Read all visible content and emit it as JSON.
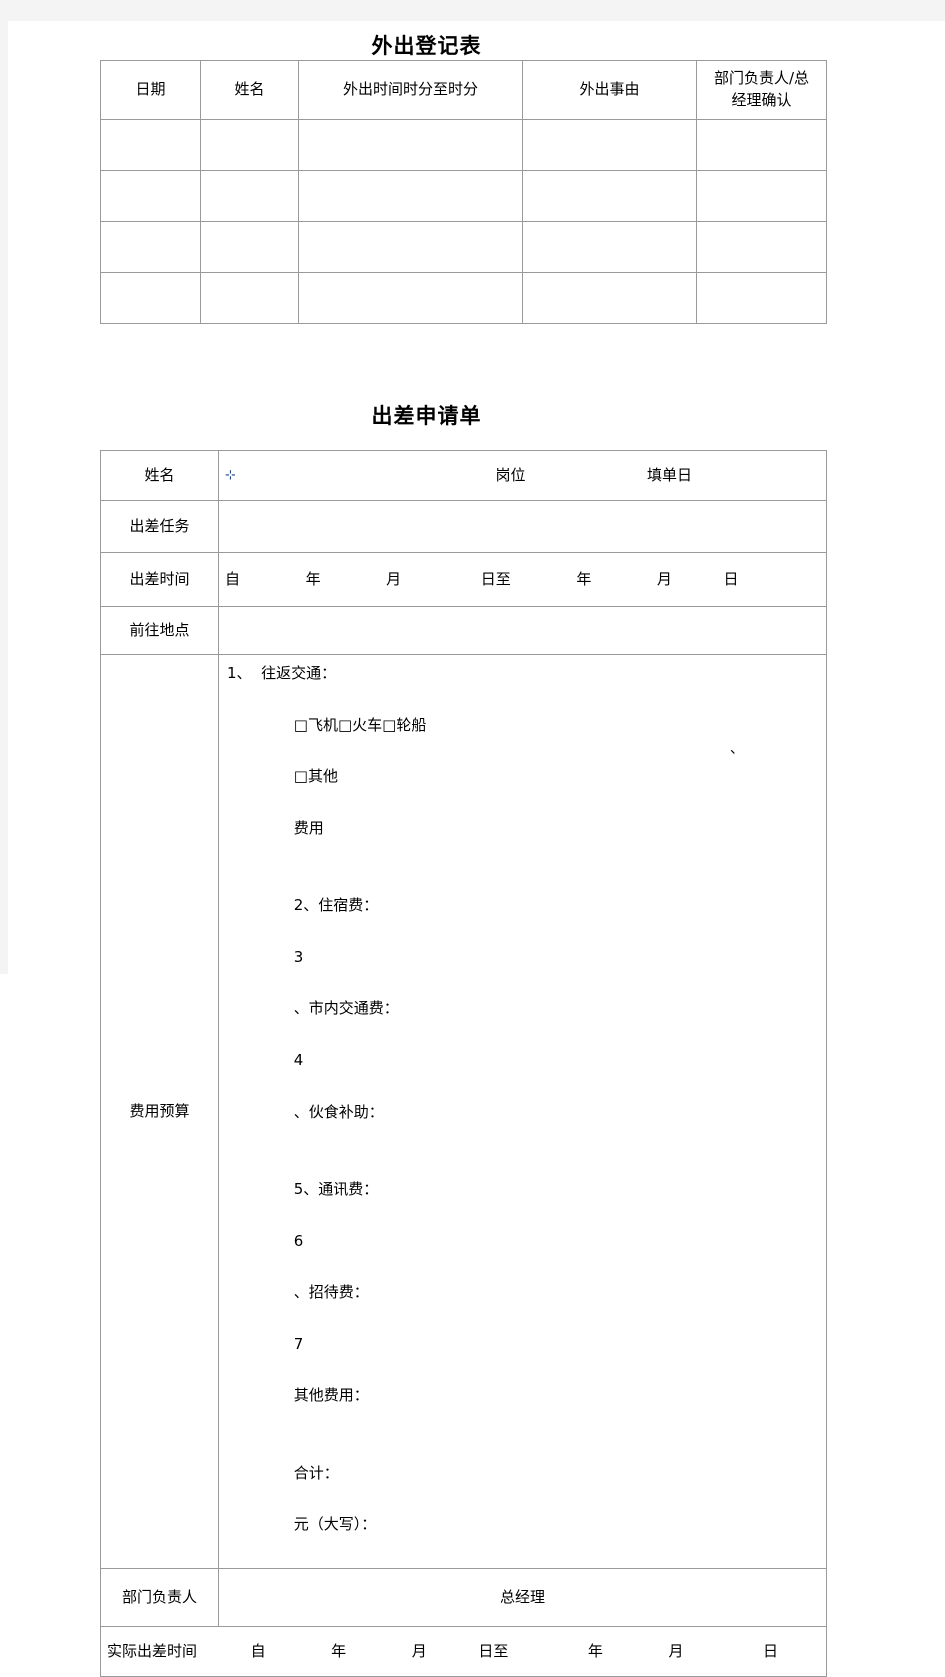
{
  "page": {
    "background_color": "#ffffff",
    "margin_band_color": "#f4f4f4",
    "border_color": "#9a9a9a"
  },
  "outing_form": {
    "title": "外出登记表",
    "columns": [
      "日期",
      "姓名",
      "外出时间时分至时分",
      "外出事由",
      "部门负责人/总"
    ],
    "header_last_line2": "经理确认",
    "empty_rows": 4,
    "cell_value": ""
  },
  "trip_form": {
    "title": "出差申请单",
    "rows": {
      "name_label": "姓名",
      "name_cursor_glyph": "⊹",
      "post_label": "岗位",
      "fill_date_label": "填单日",
      "task_label": "出差任务",
      "task_value": "",
      "time_label": "出差时间",
      "time_from": "自",
      "time_year1": "年",
      "time_month1": "月",
      "time_day_to": "日至",
      "time_year2": "年",
      "time_month2": "月",
      "time_day2": "日",
      "place_label": "前往地点",
      "place_value": "",
      "budget_label": "费用预算",
      "budget_line1": "1、  往返交通：",
      "budget_opt_plane": "□飞机",
      "budget_opt_train": "□火车",
      "budget_opt_ship": "□轮船",
      "budget_opt_other": "□其他",
      "budget_fee_word": "费用",
      "budget_item2": "2、住宿费：",
      "budget_num3": "3",
      "budget_item_city": "、市内交通费：",
      "budget_num4": "4",
      "budget_item_meal": "、伙食补助：",
      "budget_item5": "5、通讯费：",
      "budget_num6": "6",
      "budget_item_host": "、招待费：",
      "budget_num7": "7",
      "budget_item_other": "其他费用：",
      "budget_total": "合计：",
      "budget_unit": "元（大写）：",
      "budget_stray_mark": "、",
      "leader_label": "部门负责人",
      "gm_label": "总经理",
      "actual_label": "实际出差时间",
      "actual_from": "自",
      "actual_year1": "年",
      "actual_month1": "月",
      "actual_day_to": "日至",
      "actual_year2": "年",
      "actual_month2": "月",
      "actual_day2": "日"
    }
  }
}
